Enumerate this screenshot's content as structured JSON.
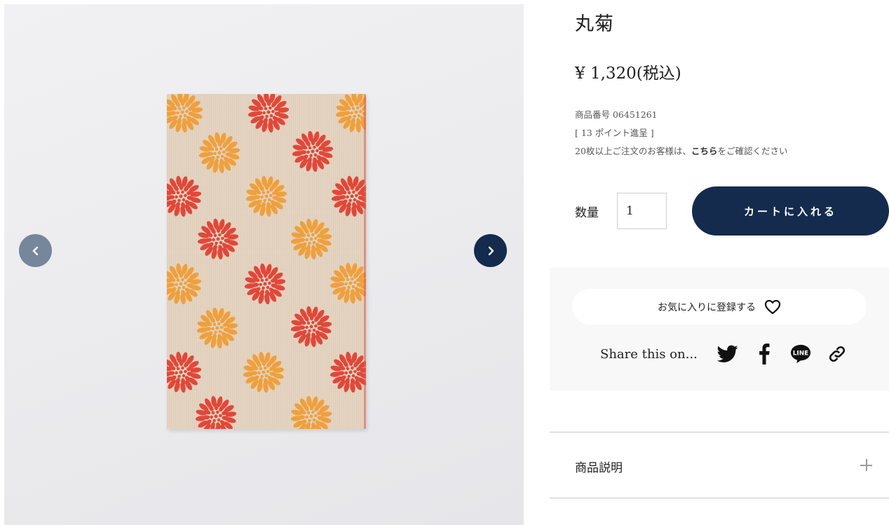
{
  "gallery": {
    "prev_icon": "chevron-left-icon",
    "next_icon": "chevron-right-icon",
    "colors": {
      "fabric": "#e4d3bf",
      "flower_red": "#e0483a",
      "flower_orange": "#efa03d"
    }
  },
  "product": {
    "title": "丸菊",
    "price": "¥ 1,320(税込)",
    "sku": "商品番号 06451261",
    "points": "[ 13 ポイント進呈 ]",
    "bulk_note_prefix": "20枚以上ご注文のお客様は、",
    "bulk_note_link": "こちら",
    "bulk_note_suffix": "をご確認ください"
  },
  "purchase": {
    "qty_label": "数量",
    "qty_value": "1",
    "cart_button": "カートに入れる",
    "accent_color": "#142b4d"
  },
  "share": {
    "favorite_label": "お気に入りに登録する",
    "favorite_icon": "heart-icon",
    "share_label": "Share this on...",
    "icons": [
      "twitter-icon",
      "facebook-icon",
      "line-icon",
      "link-icon"
    ],
    "line_text": "LINE"
  },
  "accordion": {
    "label": "商品説明",
    "toggle_icon": "plus-icon"
  }
}
